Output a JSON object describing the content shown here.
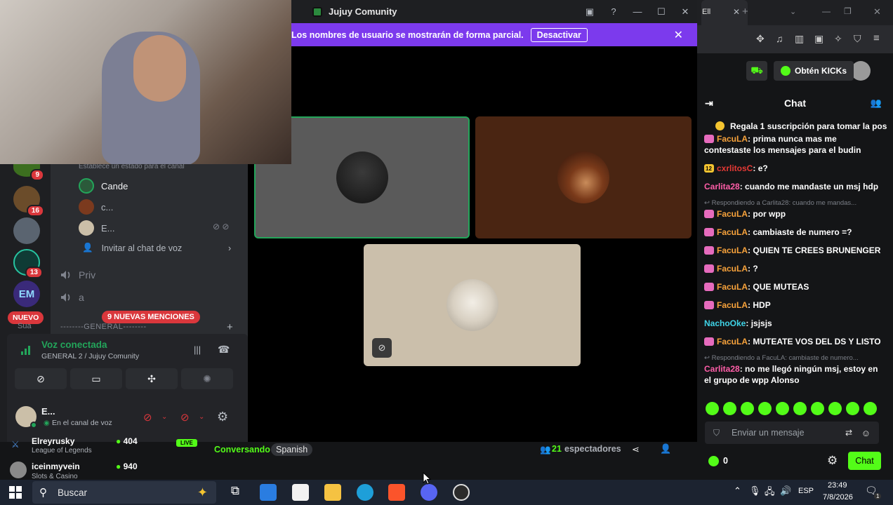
{
  "discord_window": {
    "title": "Jujuy Comunity",
    "notice_text": "Los nombres de usuario se mostrarán de forma parcial.",
    "notice_button": "Desactivar"
  },
  "server_rail": {
    "badges": [
      "9",
      "16",
      "13"
    ],
    "nuevo_label": "NUEVO"
  },
  "channels": {
    "status_note": "Establece un estado para el canal",
    "voice_users": [
      {
        "name": "Cande"
      },
      {
        "name": "c..."
      },
      {
        "name": "E..."
      }
    ],
    "invite_label": "Invitar al chat de voz",
    "categories": [
      "Priv",
      "a"
    ],
    "mentions_pill": "9 NUEVAS MENCIONES",
    "general_header": "--------GENERAL--------",
    "peek_label": "Sua"
  },
  "voice_panel": {
    "status": "Voz conectada",
    "location": "GENERAL 2 / Jujuy Comunity",
    "user_name": "E...",
    "user_status": "En el canal de voz"
  },
  "kick": {
    "browser_tab": "Ell",
    "get_kicks": "Obtén KICKs",
    "chat_title": "Chat",
    "pinned": "Regala 1 suscripción para tomar la pos",
    "messages": [
      {
        "type": "msg",
        "user": "FacuLA",
        "text": "prima nunca mas me contestaste los mensajes para el budin",
        "color": "#f7a23b"
      },
      {
        "type": "msg",
        "user": "cxrlitosC",
        "text": "e?",
        "color": "#e53935",
        "badge": "12"
      },
      {
        "type": "msg",
        "user": "Carlita28",
        "text": "cuando me mandaste un msj hdp",
        "color": "#ff5ea8"
      },
      {
        "type": "reply",
        "text": "Respondiendo a Carlita28: cuando me mandas..."
      },
      {
        "type": "msg",
        "user": "FacuLA",
        "text": "por wpp",
        "color": "#f7a23b"
      },
      {
        "type": "msg",
        "user": "FacuLA",
        "text": "cambiaste de numero =?",
        "color": "#f7a23b"
      },
      {
        "type": "msg",
        "user": "FacuLA",
        "text": "QUIEN TE CREES BRUNENGER",
        "color": "#f7a23b"
      },
      {
        "type": "msg",
        "user": "FacuLA",
        "text": "?",
        "color": "#f7a23b"
      },
      {
        "type": "msg",
        "user": "FacuLA",
        "text": "QUE MUTEAS",
        "color": "#f7a23b"
      },
      {
        "type": "msg",
        "user": "FacuLA",
        "text": "HDP",
        "color": "#f7a23b"
      },
      {
        "type": "msg",
        "user": "NachoOke",
        "text": "jsjsjs",
        "color": "#3fd4e8"
      },
      {
        "type": "msg",
        "user": "FacuLA",
        "text": "MUTEATE VOS DEL DS Y LISTO",
        "color": "#f7a23b"
      },
      {
        "type": "reply",
        "text": "Respondiendo a FacuLA: cambiaste de numero..."
      },
      {
        "type": "msg",
        "user": "Carlita28",
        "text": "no me llegó ningún msj, estoy en el grupo de wpp Alonso",
        "color": "#ff5ea8"
      }
    ],
    "input_placeholder": "Enviar un mensaje",
    "kicks_count": "0",
    "chat_button": "Chat"
  },
  "stream_bar": {
    "list": [
      {
        "name": "Elreyrusky",
        "game": "League of Legends",
        "viewers": "404"
      },
      {
        "name": "iceinmyvein",
        "game": "Slots & Casino",
        "viewers": "940"
      }
    ],
    "live": "LIVE",
    "category": "Conversando",
    "language": "Spanish",
    "viewers": "21",
    "viewers_label": "espectadores"
  },
  "taskbar": {
    "search": "Buscar",
    "lang": "ESP",
    "time": "23:49",
    "date": "7/8/2026",
    "notif": "1"
  },
  "colors": {
    "kick_green": "#53fc18",
    "discord_purple": "#7c3aed",
    "discord_green": "#23a55a",
    "danger": "#da373c"
  }
}
